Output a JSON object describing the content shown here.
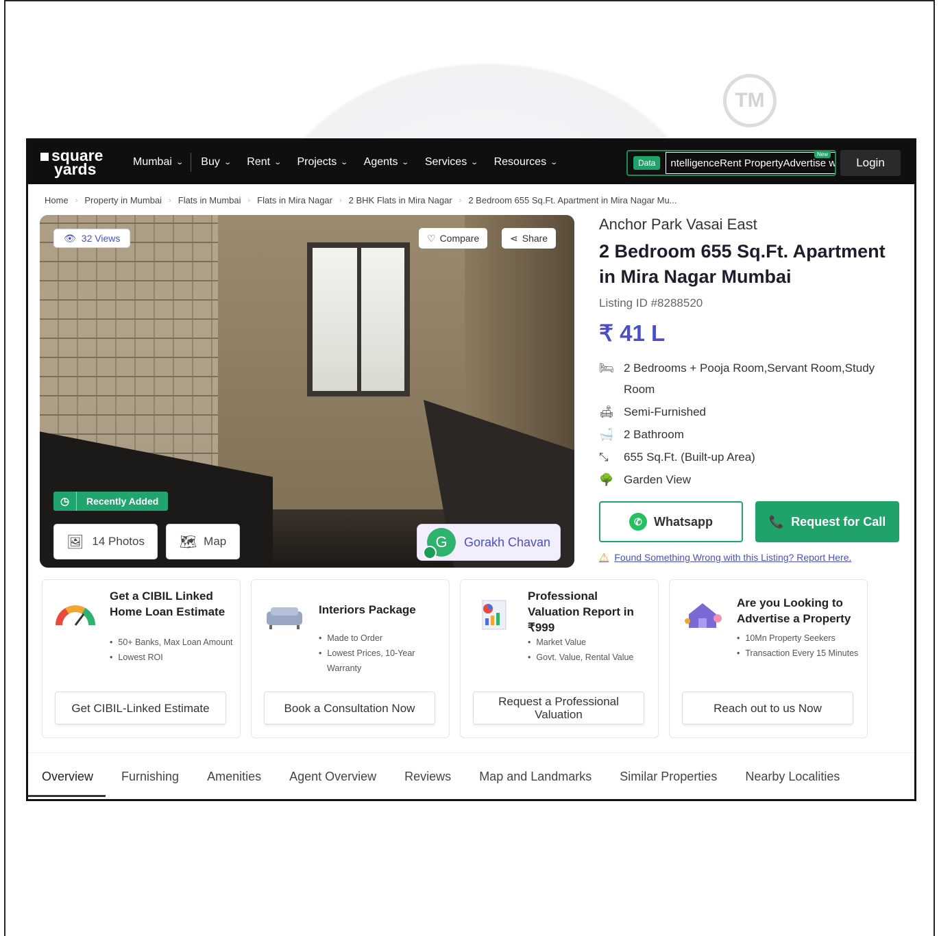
{
  "watermark": {
    "tm_label": "TM"
  },
  "nav": {
    "logo_line1": "square",
    "logo_line2": "yards",
    "items": [
      {
        "label": "Mumbai"
      },
      {
        "label": "Buy"
      },
      {
        "label": "Rent"
      },
      {
        "label": "Projects"
      },
      {
        "label": "Agents"
      },
      {
        "label": "Services"
      },
      {
        "label": "Resources"
      }
    ],
    "data_badge": "Data",
    "intel_text": "ntelligenceRent PropertyAdvertise with us",
    "new_badge": "New",
    "login": "Login"
  },
  "breadcrumbs": [
    "Home",
    "Property in Mumbai",
    "Flats in Mumbai",
    "Flats in Mira Nagar",
    "2 BHK Flats in Mira Nagar",
    "2 Bedroom 655 Sq.Ft. Apartment in Mira Nagar Mu..."
  ],
  "photo": {
    "views": "32 Views",
    "compare": "Compare",
    "share": "Share",
    "recently_added": "Recently Added",
    "photos": "14 Photos",
    "map": "Map",
    "agent_initial": "G",
    "agent_name": "Gorakh Chavan"
  },
  "listing": {
    "project": "Anchor Park Vasai East",
    "title": "2 Bedroom 655 Sq.Ft. Apartment in Mira Nagar Mumbai",
    "listing_id": "Listing ID #8288520",
    "price": "₹ 41 L",
    "features": [
      {
        "icon": "bed-icon",
        "text": "2 Bedrooms + Pooja Room,Servant Room,Study Room"
      },
      {
        "icon": "sofa-icon",
        "text": "Semi-Furnished"
      },
      {
        "icon": "bathtub-icon",
        "text": "2 Bathroom"
      },
      {
        "icon": "area-icon",
        "text": "655 Sq.Ft. (Built-up Area)"
      },
      {
        "icon": "garden-icon",
        "text": "Garden View"
      }
    ],
    "whatsapp": "Whatsapp",
    "request_call": "Request for Call",
    "report": "Found Something Wrong with this Listing? Report Here."
  },
  "cards": [
    {
      "title": "Get a CIBIL Linked Home Loan Estimate",
      "bullets": [
        "50+ Banks, Max Loan Amount",
        "Lowest ROI"
      ],
      "button": "Get CIBIL-Linked Estimate",
      "icon": "gauge-icon"
    },
    {
      "title": "Interiors Package",
      "bullets": [
        "Made to Order",
        "Lowest Prices, 10-Year Warranty"
      ],
      "button": "Book a Consultation Now",
      "icon": "sofa-illustration-icon"
    },
    {
      "title": "Professional Valuation Report in ₹999",
      "bullets": [
        "Market Value",
        "Govt. Value, Rental Value"
      ],
      "button": "Request a Professional Valuation",
      "icon": "report-chart-icon"
    },
    {
      "title": "Are you Looking to Advertise a Property",
      "bullets": [
        "10Mn Property Seekers",
        "Transaction Every 15 Minutes"
      ],
      "button": "Reach out to us Now",
      "icon": "house-megaphone-icon"
    }
  ],
  "tabs": [
    {
      "label": "Overview"
    },
    {
      "label": "Furnishing"
    },
    {
      "label": "Amenities"
    },
    {
      "label": "Agent Overview"
    },
    {
      "label": "Reviews"
    },
    {
      "label": "Map and Landmarks"
    },
    {
      "label": "Similar Properties"
    },
    {
      "label": "Nearby Localities"
    }
  ],
  "colors": {
    "accent_purple": "#4a4fc7",
    "accent_green": "#1fa36a",
    "nav_bg": "#0f0f10"
  }
}
